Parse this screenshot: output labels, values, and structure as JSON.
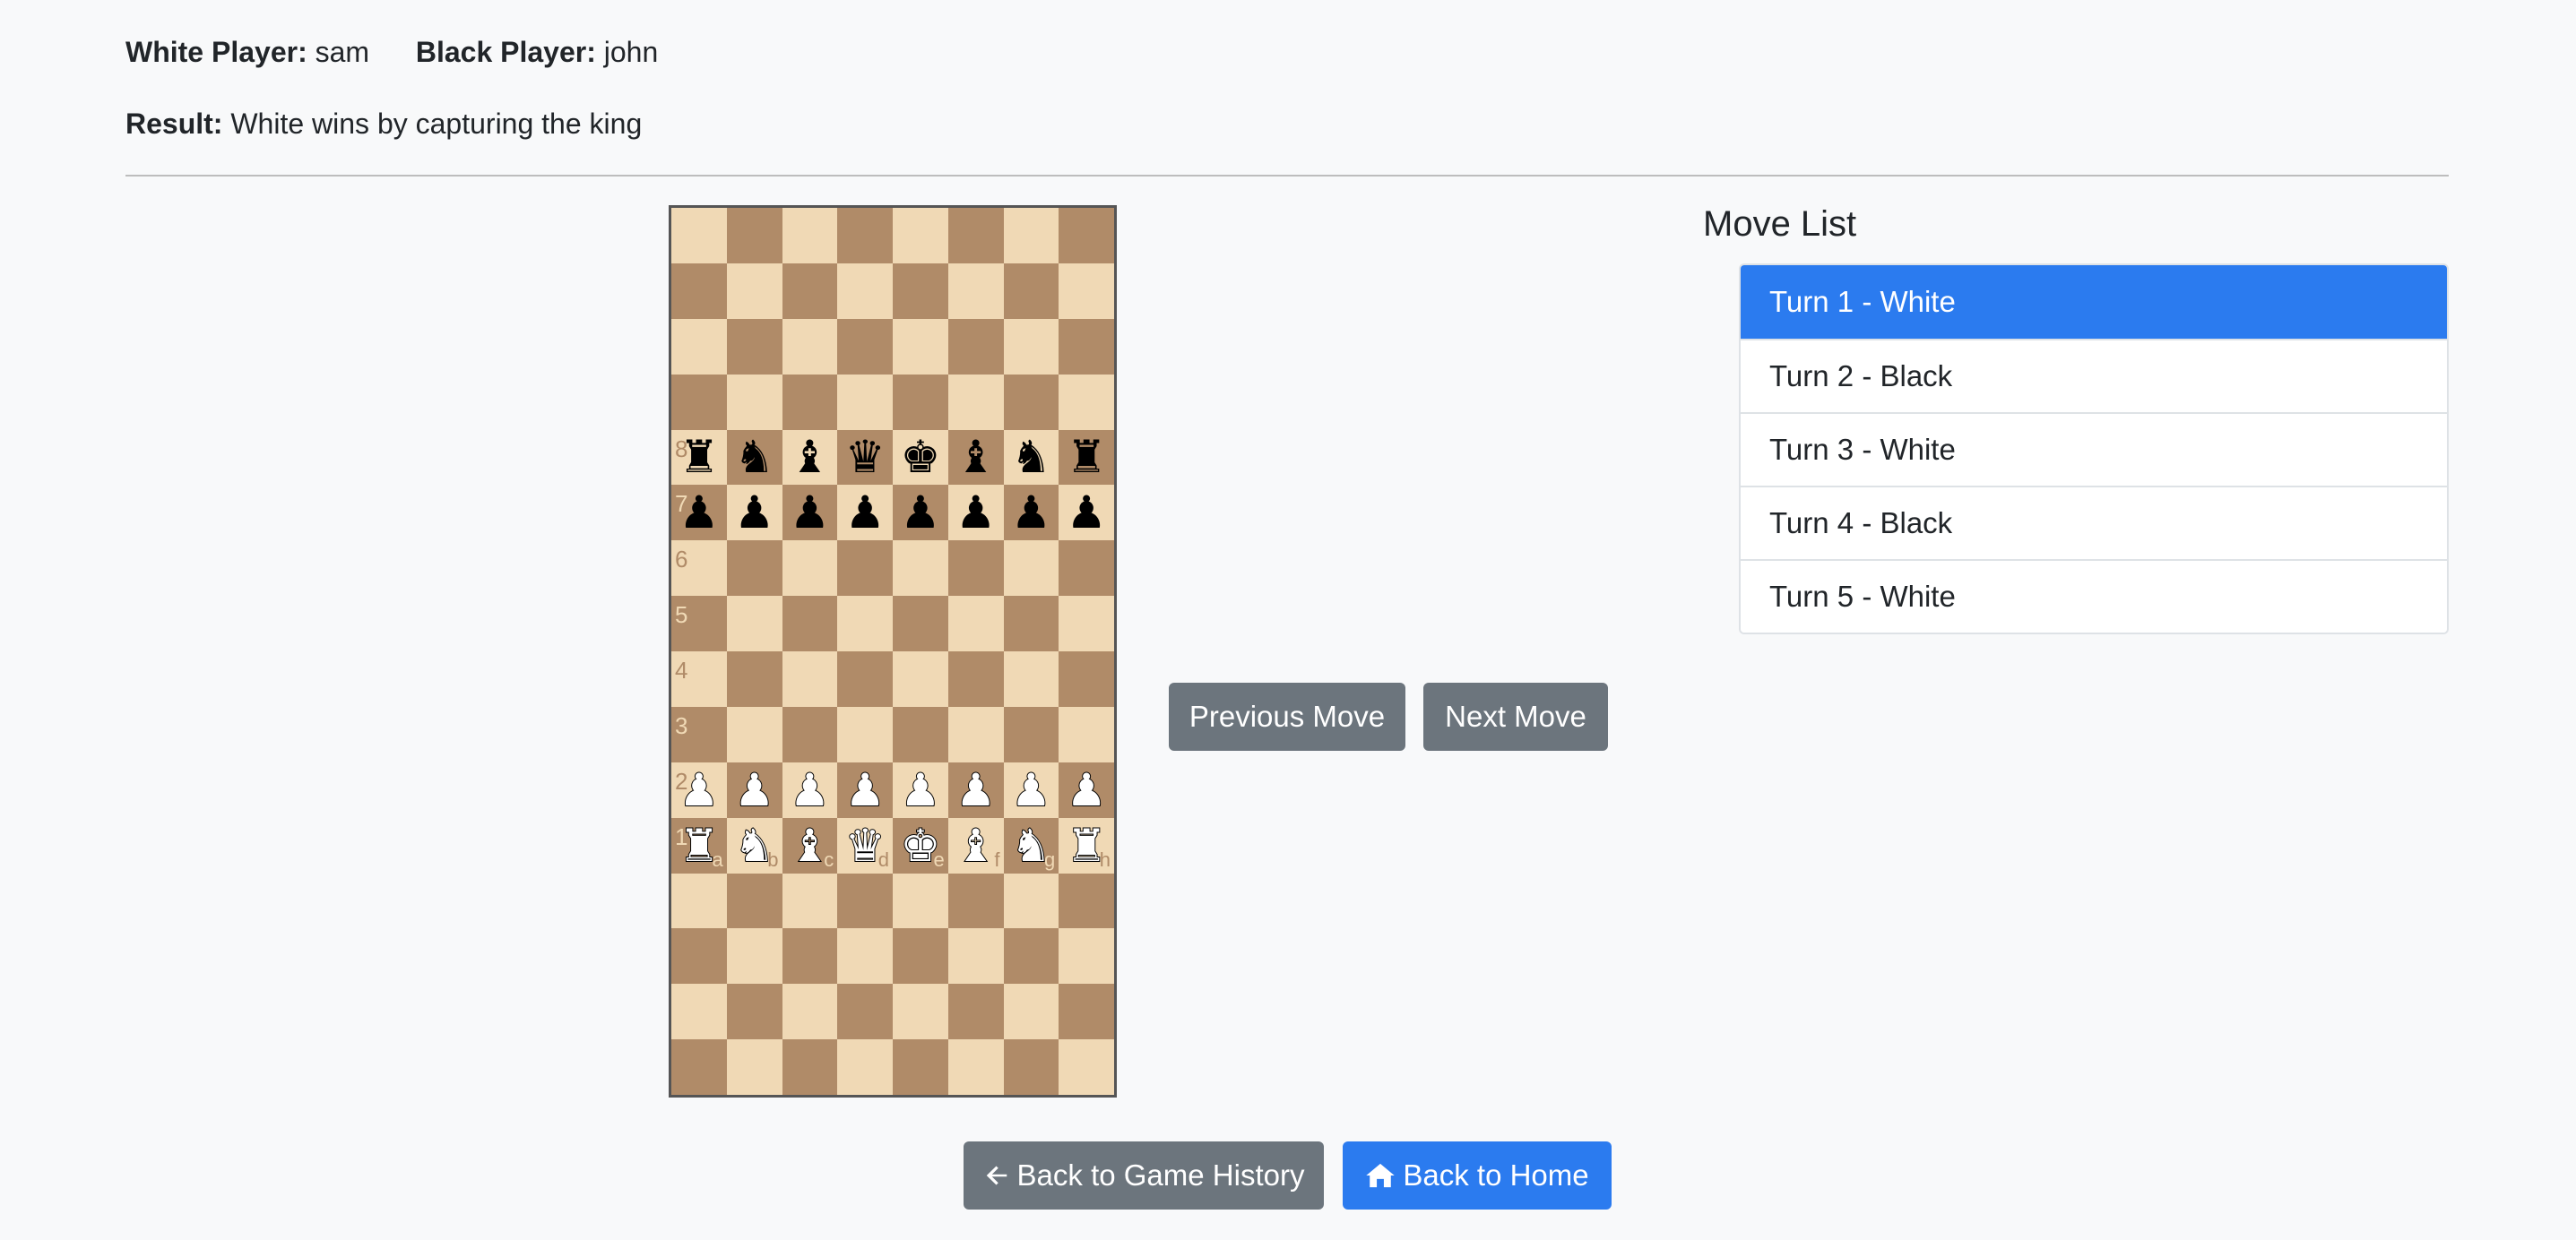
{
  "game": {
    "white_label": "White Player:",
    "white_name": "sam",
    "black_label": "Black Player:",
    "black_name": "john",
    "result_label": "Result:",
    "result_text": "White wins by capturing the king"
  },
  "board": {
    "rows": [
      [
        "",
        "",
        "",
        "",
        "",
        "",
        "",
        ""
      ],
      [
        "",
        "",
        "",
        "",
        "",
        "",
        "",
        ""
      ],
      [
        "",
        "",
        "",
        "",
        "",
        "",
        "",
        ""
      ],
      [
        "",
        "",
        "",
        "",
        "",
        "",
        "",
        ""
      ],
      [
        "br",
        "bn",
        "bb",
        "bq",
        "bk",
        "bb",
        "bn",
        "br"
      ],
      [
        "bp",
        "bp",
        "bp",
        "bp",
        "bp",
        "bp",
        "bp",
        "bp"
      ],
      [
        "",
        "",
        "",
        "",
        "",
        "",
        "",
        ""
      ],
      [
        "",
        "",
        "",
        "",
        "",
        "",
        "",
        ""
      ],
      [
        "",
        "",
        "",
        "",
        "",
        "",
        "",
        ""
      ],
      [
        "",
        "",
        "",
        "",
        "",
        "",
        "",
        ""
      ],
      [
        "wp",
        "wp",
        "wp",
        "wp",
        "wp",
        "wp",
        "wp",
        "wp"
      ],
      [
        "wr",
        "wn",
        "wb",
        "wq",
        "wk",
        "wb",
        "wn",
        "wr"
      ],
      [
        "",
        "",
        "",
        "",
        "",
        "",
        "",
        ""
      ],
      [
        "",
        "",
        "",
        "",
        "",
        "",
        "",
        ""
      ],
      [
        "",
        "",
        "",
        "",
        "",
        "",
        "",
        ""
      ],
      [
        "",
        "",
        "",
        "",
        "",
        "",
        "",
        ""
      ]
    ],
    "rank_labels": [
      "",
      "",
      "",
      "",
      "8",
      "7",
      "6",
      "5",
      "4",
      "3",
      "2",
      "1",
      "",
      "",
      "",
      ""
    ],
    "file_labels": [
      "a",
      "b",
      "c",
      "d",
      "e",
      "f",
      "g",
      "h"
    ],
    "colors": {
      "light": "#f0d9b5",
      "dark": "#b08b68"
    }
  },
  "controls": {
    "prev_label": "Previous Move",
    "next_label": "Next Move",
    "history_label": "Back to Game History",
    "history_icon": "arrow-left-icon",
    "home_label": "Back to Home",
    "home_icon": "home-icon"
  },
  "move_list": {
    "title": "Move List",
    "active_index": 0,
    "items": [
      "Turn 1 - White",
      "Turn 2 - Black",
      "Turn 3 - White",
      "Turn 4 - Black",
      "Turn 5 - White"
    ]
  },
  "colors": {
    "primary": "#2b7bef",
    "secondary": "#6c757d"
  }
}
